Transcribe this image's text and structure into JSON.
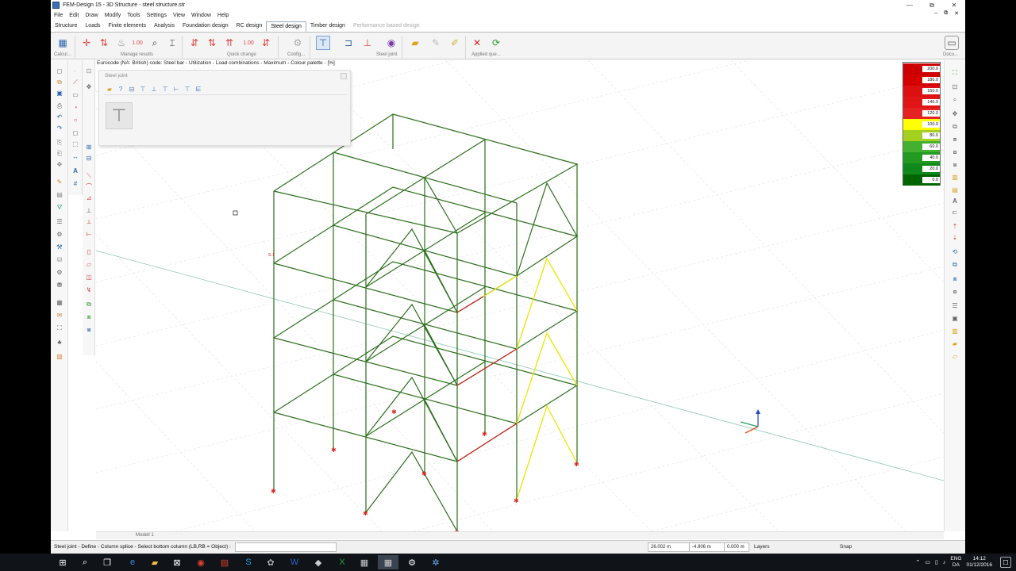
{
  "window": {
    "title": "FEM-Design 15 - 3D Structure - steel structure.str",
    "controls": [
      "—",
      "⧉",
      "✕"
    ]
  },
  "menu": {
    "items": [
      "File",
      "Edit",
      "Draw",
      "Modify",
      "Tools",
      "Settings",
      "View",
      "Window",
      "Help"
    ],
    "mdi_controls": [
      "–",
      "⧉",
      "✕"
    ]
  },
  "tabs": [
    {
      "label": "Structure",
      "state": "normal"
    },
    {
      "label": "Loads",
      "state": "normal"
    },
    {
      "label": "Finite elements",
      "state": "normal"
    },
    {
      "label": "Analysis",
      "state": "normal"
    },
    {
      "label": "Foundation design",
      "state": "normal"
    },
    {
      "label": "RC design",
      "state": "normal"
    },
    {
      "label": "Steel design",
      "state": "active"
    },
    {
      "label": "Timber design",
      "state": "normal"
    },
    {
      "label": "Performance based design",
      "state": "disabled"
    }
  ],
  "ribbon": {
    "groups": [
      "Calcul...",
      "Manage results",
      "Quick change",
      "Config...",
      "Steel joint",
      "Applied que...",
      "Docu..."
    ],
    "quick_values": [
      "1.00",
      "1.00"
    ]
  },
  "viewport": {
    "caption": "Eurocode (NA: British) code: Steel bar - Utilization - Load combinations - Maximum - Colour palette - [%]"
  },
  "panel": {
    "title": "Steel joint"
  },
  "legend": {
    "entries": [
      {
        "value": "200.0",
        "color": "#cc0000"
      },
      {
        "value": "180.0",
        "color": "#d40000"
      },
      {
        "value": "160.0",
        "color": "#dc1010"
      },
      {
        "value": "140.0",
        "color": "#e01515"
      },
      {
        "value": "120.0",
        "color": "#e52222"
      },
      {
        "value": "100.0",
        "color": "#ffff00"
      },
      {
        "value": "80.0",
        "color": "#a5d020"
      },
      {
        "value": "60.0",
        "color": "#44b030"
      },
      {
        "value": "40.0",
        "color": "#229a22"
      },
      {
        "value": "20.0",
        "color": "#0f8a1a"
      },
      {
        "value": "0.0",
        "color": "#006400"
      }
    ]
  },
  "model": {
    "tab": "Modell 1",
    "annotation": "S-1\n0.50"
  },
  "status": {
    "message": "Steel joint - Define - Column splice - Select bottom column (LB,RB = Object) :",
    "x": "26.002 m",
    "y": "-4.906 m",
    "z": "0.000 m",
    "layers_label": "Layers",
    "snap_label": "Snap"
  },
  "taskbar": {
    "lang_top": "ENG",
    "lang_bottom": "DA",
    "time": "14:12",
    "date": "01/12/2016"
  },
  "colors": {
    "structure_green": "#2a6e1a",
    "utilization_yellow": "#e8e800",
    "utilization_red": "#d02020"
  }
}
